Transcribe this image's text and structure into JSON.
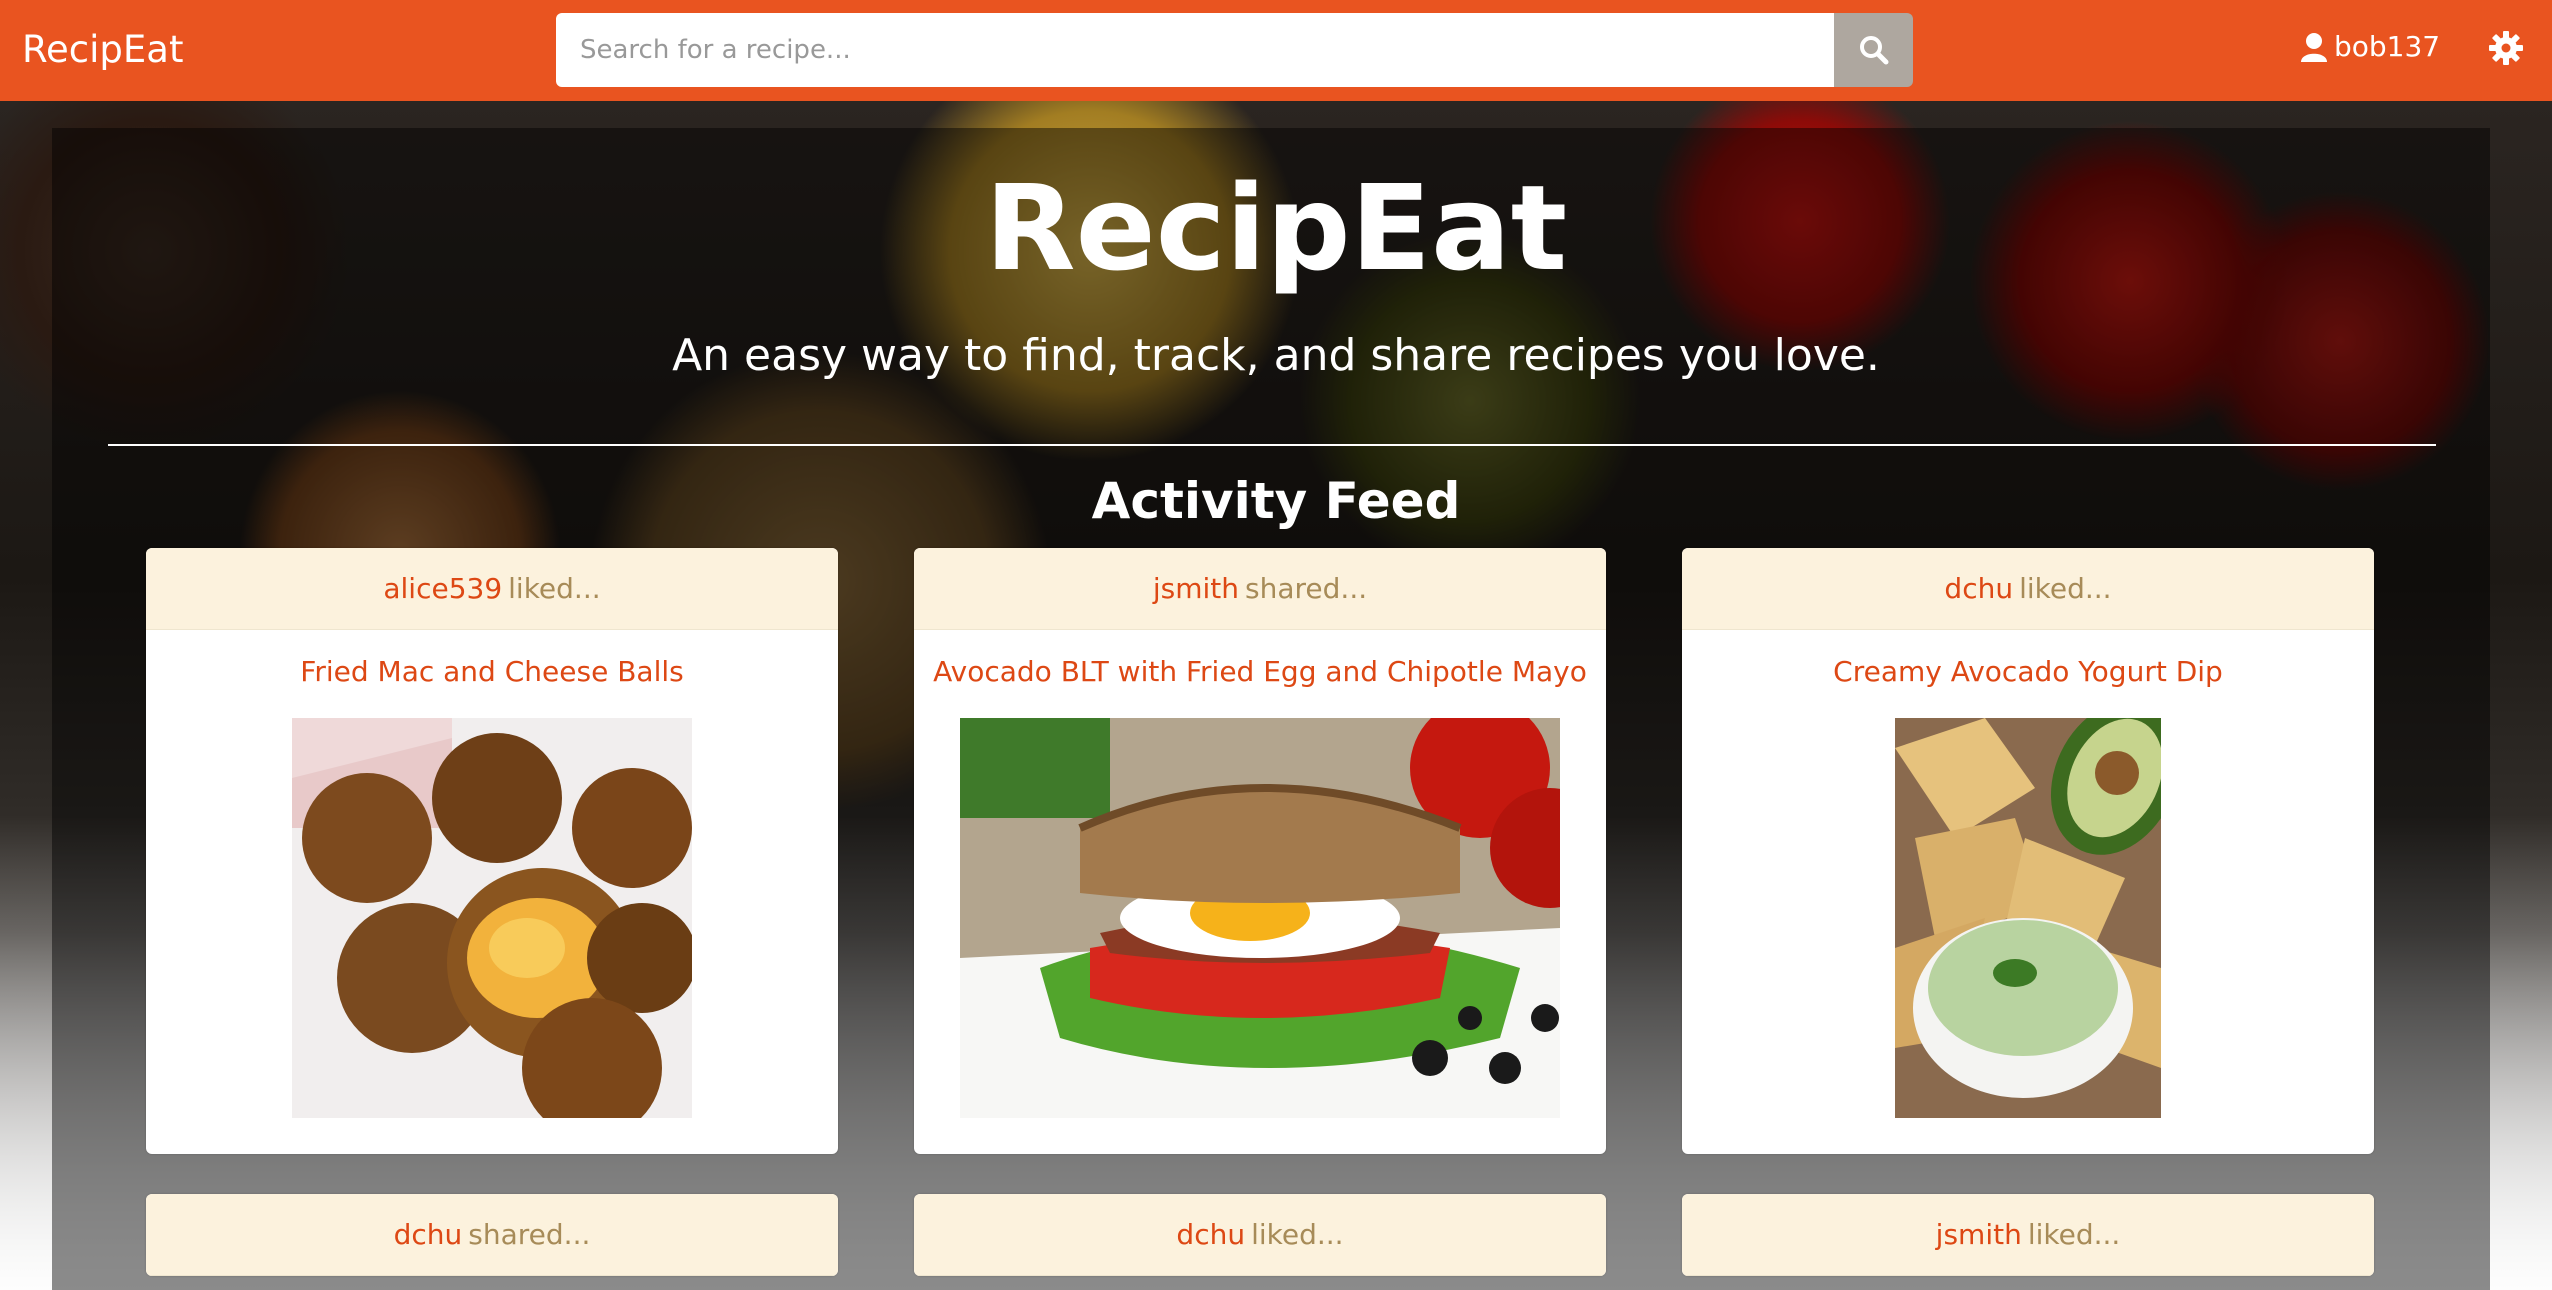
{
  "navbar": {
    "brand": "RecipEat",
    "search_placeholder": "Search for a recipe...",
    "username": "bob137"
  },
  "hero": {
    "title": "RecipEat",
    "subtitle": "An easy way to find, track, and share recipes you love."
  },
  "feed": {
    "title": "Activity Feed",
    "items": [
      {
        "user": "alice539",
        "action": "liked...",
        "recipe": "Fried Mac and Cheese Balls",
        "image_icon": "fried-mac-cheese-balls-photo"
      },
      {
        "user": "jsmith",
        "action": "shared...",
        "recipe": "Avocado BLT with Fried Egg and Chipotle Mayo",
        "image_icon": "avocado-blt-sandwich-photo"
      },
      {
        "user": "dchu",
        "action": "liked...",
        "recipe": "Creamy Avocado Yogurt Dip",
        "image_icon": "avocado-yogurt-dip-photo"
      },
      {
        "user": "dchu",
        "action": "shared..."
      },
      {
        "user": "dchu",
        "action": "liked..."
      },
      {
        "user": "jsmith",
        "action": "liked..."
      }
    ]
  },
  "colors": {
    "navbar": "#e95420",
    "accent_text": "#dd4814",
    "card_header_bg": "#fcf2dd",
    "action_text": "#a78b58",
    "search_button": "#aea79f"
  }
}
